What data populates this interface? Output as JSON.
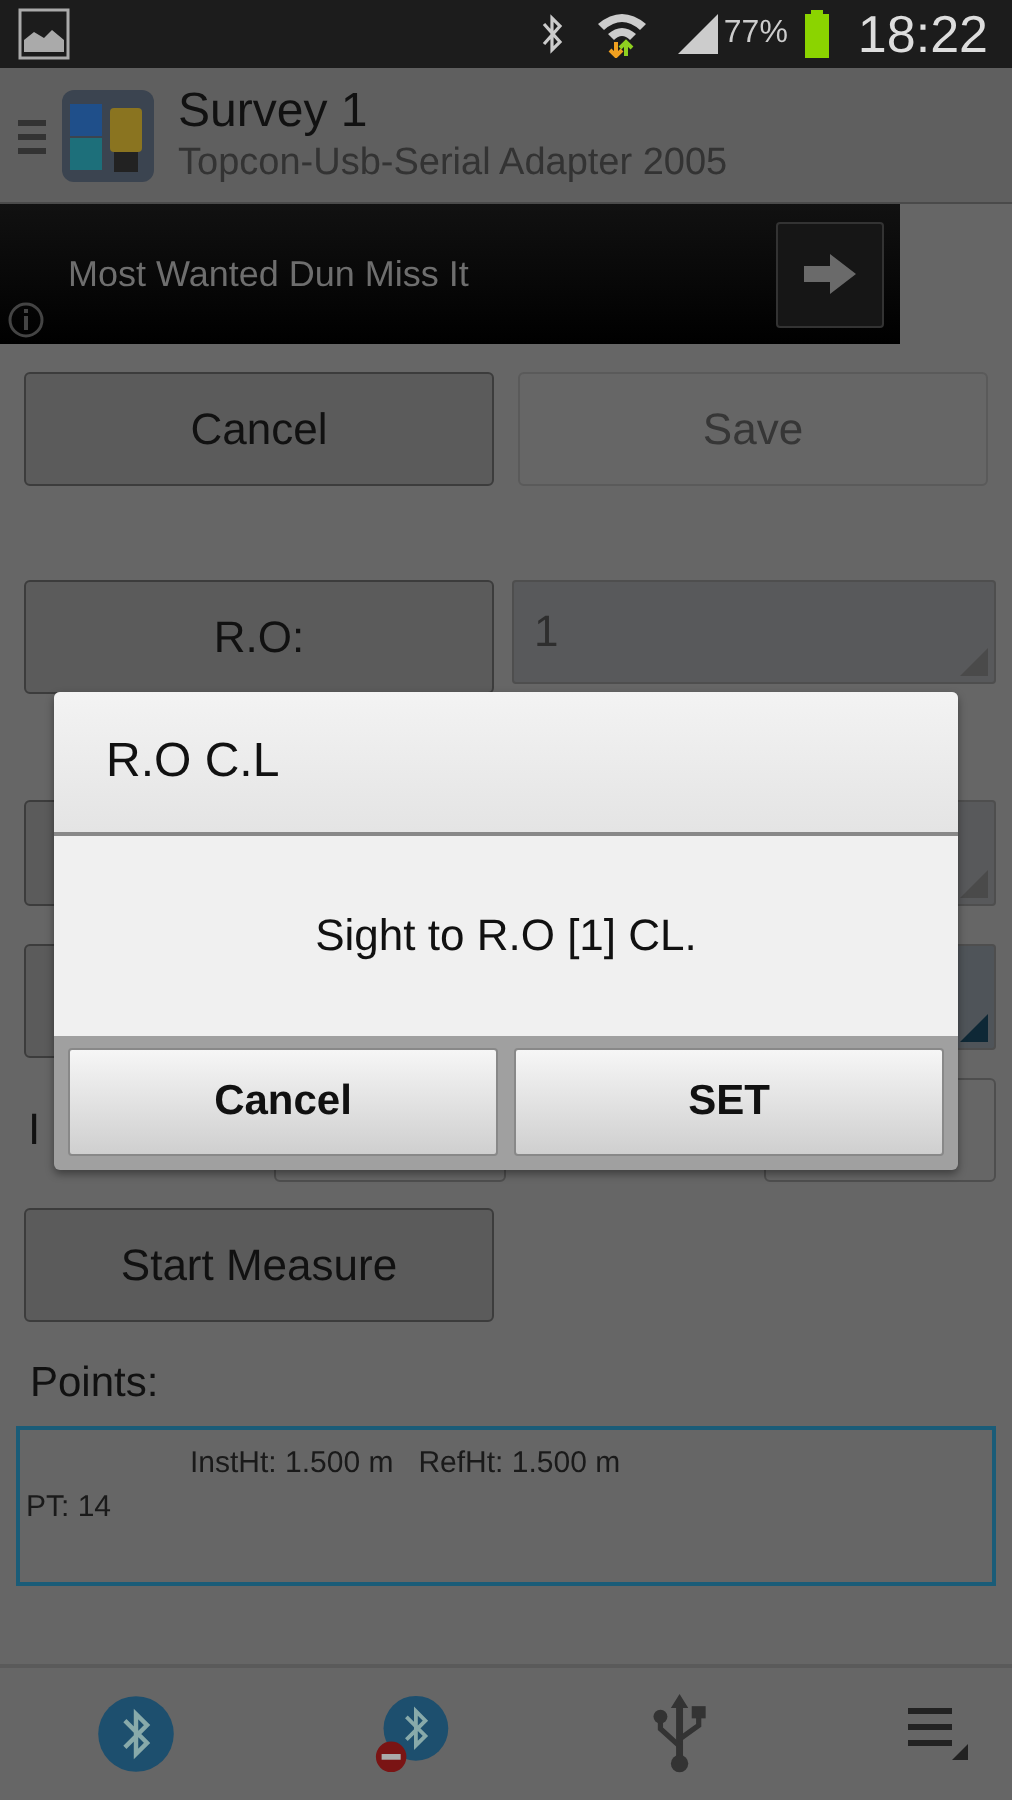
{
  "status_bar": {
    "battery": "77%",
    "time": "18:22"
  },
  "action_bar": {
    "title": "Survey 1",
    "subtitle": "Topcon-Usb-Serial Adapter 2005"
  },
  "ad": {
    "text": "Most Wanted Dun Miss It"
  },
  "buttons": [
    {
      "label": "Cancel",
      "disabled": false
    },
    {
      "label": "Save",
      "disabled": true
    }
  ],
  "ro": {
    "button": "R.O:",
    "value": "1"
  },
  "inst_row": {
    "label": "I"
  },
  "start_button": "Start Measure",
  "points": {
    "label": "Points:",
    "lines": [
      {
        "text": "InstHt: 1.500 m   RefHt: 1.500 m",
        "indented": true
      },
      {
        "text": "PT: 14",
        "indented": false
      }
    ]
  },
  "dialog": {
    "title": "R.O C.L",
    "message": "Sight to R.O [1] CL.",
    "buttons": [
      "Cancel",
      "SET"
    ]
  }
}
